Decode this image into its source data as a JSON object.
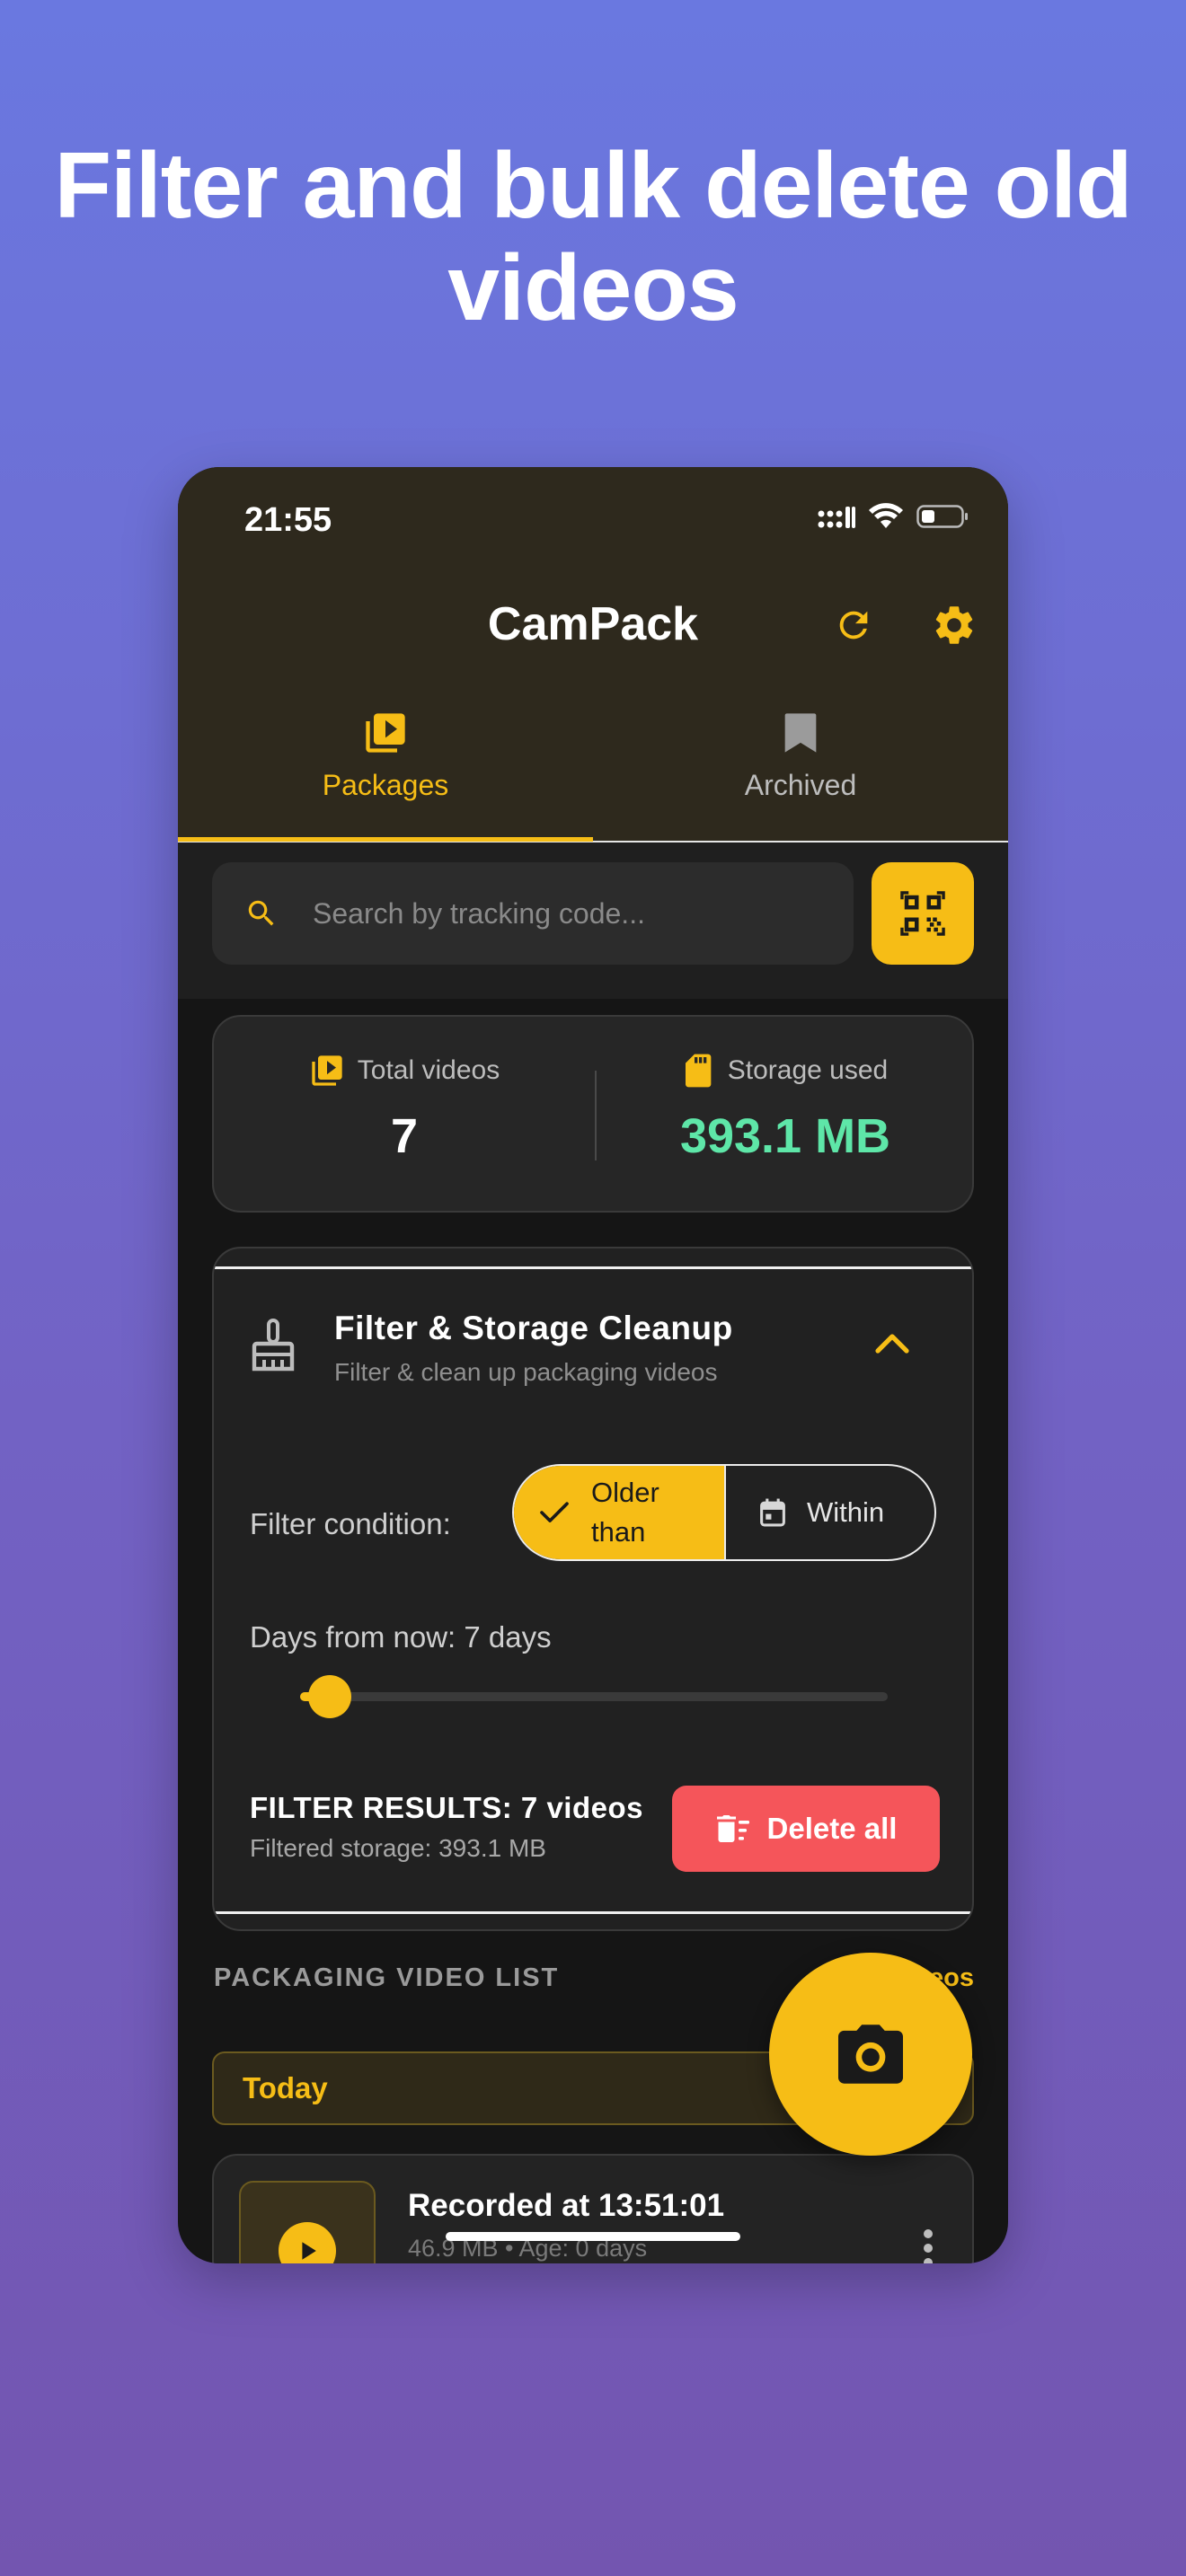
{
  "headline": "Filter and bulk delete old videos",
  "status": {
    "time": "21:55"
  },
  "app": {
    "title": "CamPack"
  },
  "tabs": [
    {
      "label": "Packages",
      "active": true
    },
    {
      "label": "Archived",
      "active": false
    }
  ],
  "search": {
    "placeholder": "Search by tracking code..."
  },
  "stats": {
    "total_label": "Total videos",
    "total_value": "7",
    "storage_label": "Storage used",
    "storage_value": "393.1 MB"
  },
  "filter": {
    "title": "Filter & Storage Cleanup",
    "subtitle": "Filter & clean up packaging videos",
    "condition_label": "Filter condition:",
    "option_older_line1": "Older",
    "option_older_line2": "than",
    "option_within": "Within",
    "days_label": "Days from now: 7 days",
    "slider_fraction": 0.05,
    "results_title": "FILTER RESULTS: 7 videos",
    "results_storage": "Filtered storage: 393.1 MB",
    "delete_label": "Delete all"
  },
  "list": {
    "section_title": "PACKAGING VIDEO LIST",
    "section_action": "eos",
    "group_label": "Today",
    "items": [
      {
        "title": "Recorded at 13:51:01",
        "meta": "46.9 MB • Age: 0 days"
      }
    ]
  },
  "colors": {
    "accent": "#f6bd16",
    "storage_value": "#5ee6a8",
    "danger": "#f5555a",
    "appbar": "#2e291d"
  }
}
